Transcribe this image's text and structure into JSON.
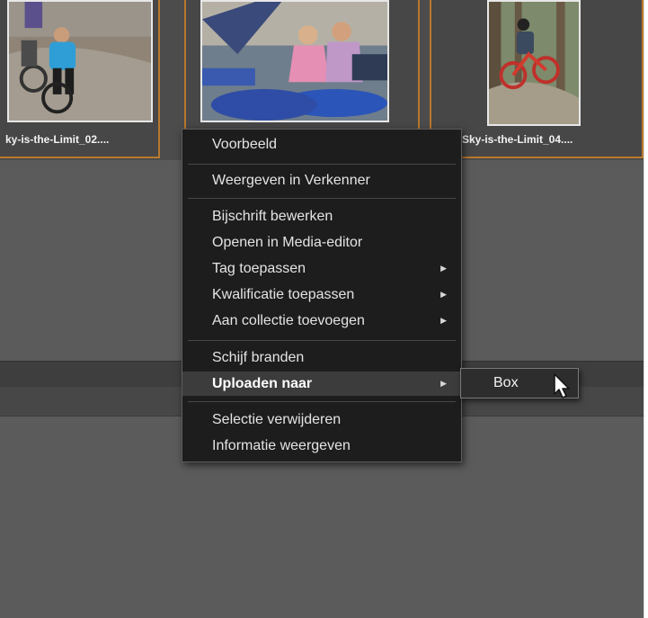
{
  "gallery": {
    "items": [
      {
        "caption": "ky-is-the-Limit_02....",
        "image": "photo of cyclists on a dirt trail"
      },
      {
        "caption": "",
        "image": "photo of girls on blue bicycles"
      },
      {
        "caption": "-Sky-is-the-Limit_04....",
        "image": "photo of rider on red bike in woods"
      }
    ]
  },
  "context_menu": {
    "groups": [
      {
        "items": [
          {
            "label": "Voorbeeld"
          }
        ]
      },
      {
        "items": [
          {
            "label": "Weergeven in Verkenner"
          }
        ]
      },
      {
        "items": [
          {
            "label": "Bijschrift bewerken"
          },
          {
            "label": "Openen in Media-editor"
          },
          {
            "label": "Tag toepassen",
            "submenu": true
          },
          {
            "label": "Kwalificatie toepassen",
            "submenu": true
          },
          {
            "label": "Aan collectie toevoegen",
            "submenu": true
          }
        ]
      },
      {
        "items": [
          {
            "label": "Schijf branden"
          },
          {
            "label": "Uploaden naar",
            "submenu": true,
            "highlighted": true
          }
        ]
      },
      {
        "items": [
          {
            "label": "Selectie verwijderen"
          },
          {
            "label": "Informatie weergeven"
          }
        ]
      }
    ],
    "submenu_icon": "triangle-right-icon"
  },
  "submenu": {
    "items": [
      {
        "label": "Box"
      }
    ]
  },
  "cursor_icon": "arrow-cursor-icon",
  "colors": {
    "selection_border": "#b8782d",
    "menu_background": "#1d1d1d",
    "highlight": "#3c3c3c",
    "panel": "#5b5b5b"
  }
}
